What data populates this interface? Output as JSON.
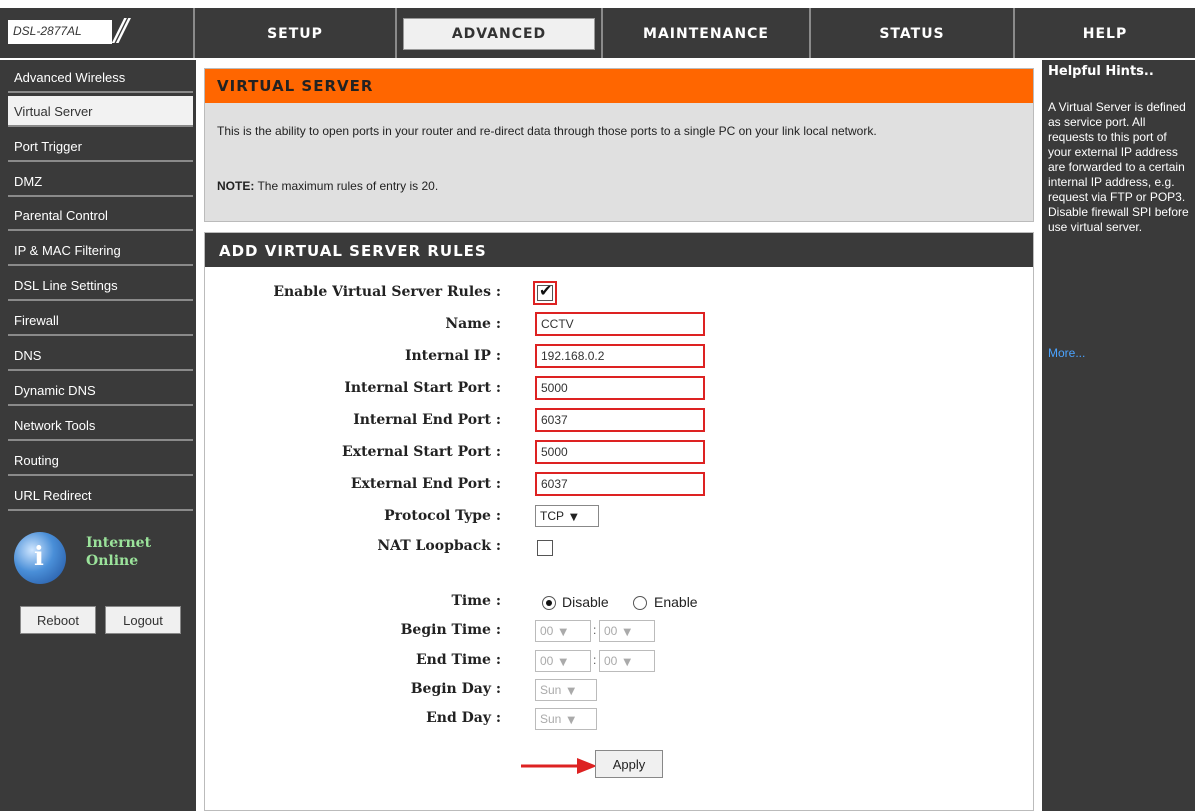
{
  "device": {
    "model": "DSL-2877AL",
    "slashes": "//"
  },
  "nav_tabs": [
    "SETUP",
    "ADVANCED",
    "MAINTENANCE",
    "STATUS",
    "HELP"
  ],
  "active_tab": "ADVANCED",
  "sidebar": {
    "items": [
      "Advanced Wireless",
      "Virtual Server",
      "Port Trigger",
      "DMZ",
      "Parental Control",
      "IP & MAC Filtering",
      "DSL Line Settings",
      "Firewall",
      "DNS",
      "Dynamic DNS",
      "Network Tools",
      "Routing",
      "URL Redirect"
    ],
    "active": "Virtual Server",
    "status_line1": "Internet",
    "status_line2": "Online",
    "reboot_label": "Reboot",
    "logout_label": "Logout"
  },
  "virtual_server": {
    "title": "VIRTUAL SERVER",
    "description": "This is the ability to open ports in your router and re-direct data through those ports to a single PC on your link local network.",
    "note_label": "NOTE:",
    "note_text": " The maximum rules of entry is 20."
  },
  "rules": {
    "title": "ADD VIRTUAL SERVER RULES",
    "enable_label": "Enable Virtual Server Rules :",
    "enable_checked": true,
    "name_label": "Name :",
    "name_value": "CCTV",
    "internal_ip_label": "Internal IP :",
    "internal_ip_value": "192.168.0.2",
    "internal_start_label": "Internal Start Port :",
    "internal_start_value": "5000",
    "internal_end_label": "Internal End Port :",
    "internal_end_value": "6037",
    "external_start_label": "External Start Port :",
    "external_start_value": "5000",
    "external_end_label": "External End Port :",
    "external_end_value": "6037",
    "protocol_label": "Protocol Type :",
    "protocol_value": "TCP",
    "nat_label": "NAT Loopback :",
    "nat_checked": false,
    "time_label": "Time :",
    "time_disable": "Disable",
    "time_enable": "Enable",
    "time_selected": "Disable",
    "begin_time_label": "Begin Time :",
    "begin_hour": "00",
    "begin_min": "00",
    "end_time_label": "End Time :",
    "end_hour": "00",
    "end_min": "00",
    "begin_day_label": "Begin Day :",
    "begin_day_value": "Sun",
    "end_day_label": "End Day :",
    "end_day_value": "Sun",
    "apply_label": "Apply"
  },
  "hints": {
    "title": "Helpful Hints..",
    "text": "A Virtual Server is defined as service port. All requests to this port of your external IP address are forwarded to a certain internal IP address, e.g. request via FTP or POP3. Disable firewall SPI before use virtual server.",
    "more": "More..."
  },
  "colors": {
    "header_orange": "#ff6600",
    "dark_gray": "#3a3a3a",
    "highlight_red": "#dd2222",
    "link_blue": "#4aa3ff"
  }
}
